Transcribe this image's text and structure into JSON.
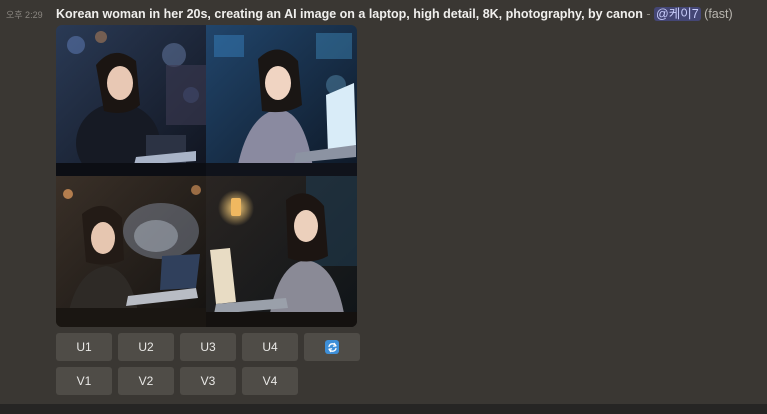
{
  "message": {
    "timestamp": "오후 2:29",
    "prompt": "Korean woman in her 20s, creating an AI image on a laptop, high detail, 8K, photography, by canon",
    "separator": " - ",
    "mention": "@케이7",
    "speed": "(fast)"
  },
  "images": [
    {
      "name": "image-1"
    },
    {
      "name": "image-2"
    },
    {
      "name": "image-3"
    },
    {
      "name": "image-4"
    }
  ],
  "buttons": {
    "upscale": [
      "U1",
      "U2",
      "U3",
      "U4"
    ],
    "refresh_icon": "refresh-icon",
    "variation": [
      "V1",
      "V2",
      "V3",
      "V4"
    ]
  },
  "colors": {
    "background": "#3a3733",
    "button": "#4f4c47",
    "mention_bg": "#5865f2",
    "refresh_icon_bg": "#3e8fd8"
  }
}
